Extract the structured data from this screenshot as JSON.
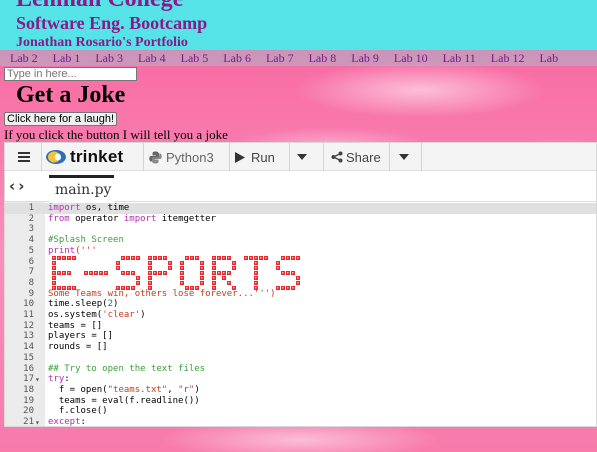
{
  "site": {
    "college": "Lehman College",
    "course": "Software Eng. Bootcamp",
    "author": "Jonathan Rosario's Portfolio"
  },
  "nav": {
    "labs": [
      "Lab 2",
      "Lab 1",
      "Lab 3",
      "Lab 4",
      "Lab 5",
      "Lab 6",
      "Lab 7",
      "Lab 8",
      "Lab 9",
      "Lab 10",
      "Lab 11",
      "Lab 12",
      "Lab"
    ]
  },
  "search": {
    "placeholder": "Type in here..."
  },
  "joke": {
    "title": "Get a Joke",
    "button_label": "Click here for a laugh!",
    "caption": "If you click the button I will tell you a joke"
  },
  "trinket": {
    "logo_text": "trinket",
    "language": "Python3",
    "run_label": "Run",
    "share_label": "Share",
    "file_tab": "main.py",
    "art_text": "E-SPORTS",
    "code": [
      {
        "n": "1",
        "fold": "",
        "tokens": [
          {
            "t": "import",
            "c": "kw"
          },
          {
            "t": " os, time",
            "c": "plain"
          }
        ]
      },
      {
        "n": "2",
        "fold": "",
        "tokens": [
          {
            "t": "from",
            "c": "kw"
          },
          {
            "t": " operator ",
            "c": "plain"
          },
          {
            "t": "import",
            "c": "kw"
          },
          {
            "t": " itemgetter",
            "c": "plain"
          }
        ]
      },
      {
        "n": "3",
        "fold": "",
        "tokens": []
      },
      {
        "n": "4",
        "fold": "",
        "tokens": [
          {
            "t": "#Splash Screen",
            "c": "com"
          }
        ]
      },
      {
        "n": "5",
        "fold": "",
        "tokens": [
          {
            "t": "print",
            "c": "kw"
          },
          {
            "t": "('''",
            "c": "str"
          }
        ]
      },
      {
        "n": "6",
        "fold": "",
        "tokens": []
      },
      {
        "n": "7",
        "fold": "",
        "tokens": []
      },
      {
        "n": "8",
        "fold": "",
        "tokens": []
      },
      {
        "n": "9",
        "fold": "",
        "tokens": [
          {
            "t": "Some Teams win, others lose forever...''')",
            "c": "str"
          }
        ]
      },
      {
        "n": "10",
        "fold": "",
        "tokens": [
          {
            "t": "time.sleep(",
            "c": "plain"
          },
          {
            "t": "2",
            "c": "num-lit"
          },
          {
            "t": ")",
            "c": "plain"
          }
        ]
      },
      {
        "n": "11",
        "fold": "",
        "tokens": [
          {
            "t": "os.system(",
            "c": "plain"
          },
          {
            "t": "'clear'",
            "c": "str"
          },
          {
            "t": ")",
            "c": "plain"
          }
        ]
      },
      {
        "n": "12",
        "fold": "",
        "tokens": [
          {
            "t": "teams = []",
            "c": "plain"
          }
        ]
      },
      {
        "n": "13",
        "fold": "",
        "tokens": [
          {
            "t": "players = []",
            "c": "plain"
          }
        ]
      },
      {
        "n": "14",
        "fold": "",
        "tokens": [
          {
            "t": "rounds = []",
            "c": "plain"
          }
        ]
      },
      {
        "n": "15",
        "fold": "",
        "tokens": []
      },
      {
        "n": "16",
        "fold": "",
        "tokens": [
          {
            "t": "## Try to open the text files",
            "c": "com"
          }
        ]
      },
      {
        "n": "17",
        "fold": "▾",
        "tokens": [
          {
            "t": "try",
            "c": "kw"
          },
          {
            "t": ":",
            "c": "plain"
          }
        ]
      },
      {
        "n": "18",
        "fold": "",
        "tokens": [
          {
            "t": "  f = open(",
            "c": "plain"
          },
          {
            "t": "\"teams.txt\"",
            "c": "str"
          },
          {
            "t": ", ",
            "c": "plain"
          },
          {
            "t": "\"r\"",
            "c": "str"
          },
          {
            "t": ")",
            "c": "plain"
          }
        ]
      },
      {
        "n": "19",
        "fold": "",
        "tokens": [
          {
            "t": "  teams = eval(f.readline())",
            "c": "plain"
          }
        ]
      },
      {
        "n": "20",
        "fold": "",
        "tokens": [
          {
            "t": "  f.close()",
            "c": "plain"
          }
        ]
      },
      {
        "n": "21",
        "fold": "▾",
        "tokens": [
          {
            "t": "except",
            "c": "kw"
          },
          {
            "t": ":",
            "c": "plain"
          }
        ]
      }
    ]
  },
  "colors": {
    "header_bg": "#55e3e8",
    "header_text": "#8a1a8a",
    "page_bg": "#f76aa3",
    "art_red": "#e8282a"
  },
  "icons": [
    "menu-icon",
    "trinket-logo-icon",
    "python-icon",
    "play-icon",
    "chevron-down-icon",
    "share-icon",
    "back-arrow-icon",
    "forward-arrow-icon"
  ]
}
